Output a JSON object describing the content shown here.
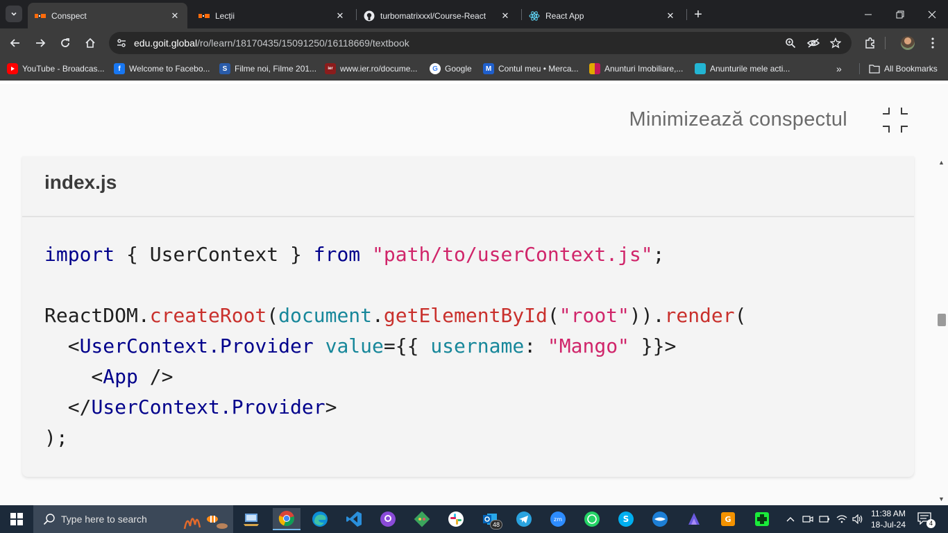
{
  "browser": {
    "tabs": [
      {
        "title": "Conspect",
        "active": true,
        "favicon": "goit-icon"
      },
      {
        "title": "Lecții",
        "active": false,
        "favicon": "goit-icon"
      },
      {
        "title": "turbomatrixxxl/Course-React",
        "active": false,
        "favicon": "github-icon"
      },
      {
        "title": "React App",
        "active": false,
        "favicon": "react-icon"
      }
    ],
    "url": {
      "host": "edu.goit.global",
      "path": "/ro/learn/18170435/15091250/16118669/textbook"
    },
    "bookmarks": [
      {
        "label": "YouTube - Broadcas...",
        "icon": "youtube-icon",
        "color": "#ff0000"
      },
      {
        "label": "Welcome to Facebo...",
        "icon": "facebook-icon",
        "color": "#1877f2"
      },
      {
        "label": "Filme noi, Filme 201...",
        "icon": "filme-icon",
        "color": "#2a5caa"
      },
      {
        "label": "www.ier.ro/docume...",
        "icon": "ier-icon",
        "color": "#8b1c1c"
      },
      {
        "label": "Google",
        "icon": "google-icon",
        "color": "#ffffff"
      },
      {
        "label": "Contul meu • Merca...",
        "icon": "mercado-icon",
        "color": "#1f5fcc"
      },
      {
        "label": "Anunturi Imobiliare,...",
        "icon": "imobiliare-icon",
        "color": "#e0a800"
      },
      {
        "label": "Anunturile mele acti...",
        "icon": "olx-icon",
        "color": "#23b5d3"
      }
    ],
    "all_bookmarks": "All Bookmarks"
  },
  "page": {
    "minimize_label": "Minimizează conspectul",
    "filename": "index.js",
    "code_lines": [
      [
        {
          "t": "import",
          "c": "kw"
        },
        {
          "t": " { UserContext } ",
          "c": ""
        },
        {
          "t": "from",
          "c": "kw"
        },
        {
          "t": " ",
          "c": ""
        },
        {
          "t": "\"path/to/userContext.js\"",
          "c": "str"
        },
        {
          "t": ";",
          "c": ""
        }
      ],
      [],
      [
        {
          "t": "ReactDOM.",
          "c": ""
        },
        {
          "t": "createRoot",
          "c": "fn"
        },
        {
          "t": "(",
          "c": ""
        },
        {
          "t": "document",
          "c": "obj"
        },
        {
          "t": ".",
          "c": ""
        },
        {
          "t": "getElementById",
          "c": "fn"
        },
        {
          "t": "(",
          "c": ""
        },
        {
          "t": "\"root\"",
          "c": "str"
        },
        {
          "t": ")).",
          "c": ""
        },
        {
          "t": "render",
          "c": "fn"
        },
        {
          "t": "(",
          "c": ""
        }
      ],
      [
        {
          "t": "  <",
          "c": ""
        },
        {
          "t": "UserContext.Provider",
          "c": "tag"
        },
        {
          "t": " ",
          "c": ""
        },
        {
          "t": "value",
          "c": "attr"
        },
        {
          "t": "={{ ",
          "c": ""
        },
        {
          "t": "username",
          "c": "attr"
        },
        {
          "t": ": ",
          "c": ""
        },
        {
          "t": "\"Mango\"",
          "c": "str"
        },
        {
          "t": " }}>",
          "c": ""
        }
      ],
      [
        {
          "t": "    <",
          "c": ""
        },
        {
          "t": "App",
          "c": "tag"
        },
        {
          "t": " />",
          "c": ""
        }
      ],
      [
        {
          "t": "  </",
          "c": ""
        },
        {
          "t": "UserContext.Provider",
          "c": "tag"
        },
        {
          "t": ">",
          "c": ""
        }
      ],
      [
        {
          "t": ");",
          "c": ""
        }
      ]
    ]
  },
  "taskbar": {
    "search_placeholder": "Type here to search",
    "apps": [
      {
        "name": "file-explorer-icon"
      },
      {
        "name": "chrome-icon",
        "active": true
      },
      {
        "name": "edge-icon"
      },
      {
        "name": "vscode-icon"
      },
      {
        "name": "github-desktop-icon"
      },
      {
        "name": "git-icon"
      },
      {
        "name": "slack-icon"
      },
      {
        "name": "outlook-icon",
        "badge": "48"
      },
      {
        "name": "telegram-icon"
      },
      {
        "name": "zoom-icon"
      },
      {
        "name": "whatsapp-icon"
      },
      {
        "name": "skype-icon"
      },
      {
        "name": "sourcetree-icon"
      },
      {
        "name": "copilot-icon"
      },
      {
        "name": "pdf-icon"
      },
      {
        "name": "game-icon"
      }
    ],
    "time": "11:38 AM",
    "date": "18-Jul-24",
    "notification_count": "4"
  }
}
